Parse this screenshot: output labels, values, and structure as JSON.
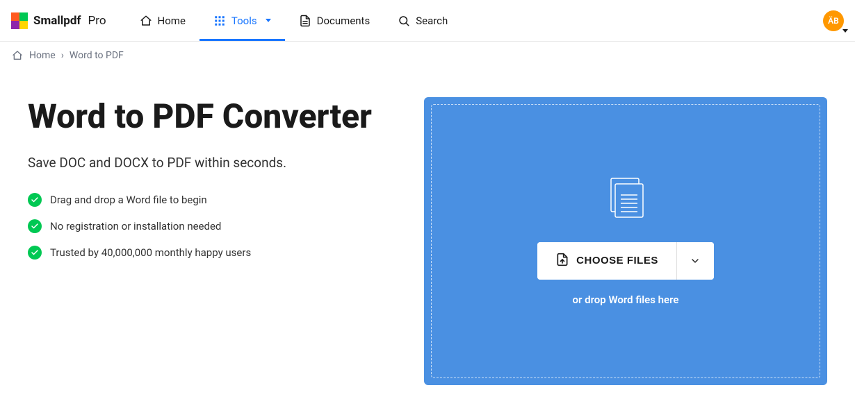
{
  "brand": {
    "name": "Smallpdf",
    "tier": "Pro"
  },
  "nav": {
    "home": "Home",
    "tools": "Tools",
    "documents": "Documents",
    "search": "Search"
  },
  "avatar": {
    "initials": "ÄB"
  },
  "breadcrumb": {
    "home": "Home",
    "separator": "›",
    "current": "Word to PDF"
  },
  "page": {
    "title": "Word to PDF Converter",
    "subtitle": "Save DOC and DOCX to PDF within seconds.",
    "features": [
      "Drag and drop a Word file to begin",
      "No registration or installation needed",
      "Trusted by 40,000,000 monthly happy users"
    ]
  },
  "dropzone": {
    "choose_label": "CHOOSE FILES",
    "hint": "or drop Word files here"
  }
}
